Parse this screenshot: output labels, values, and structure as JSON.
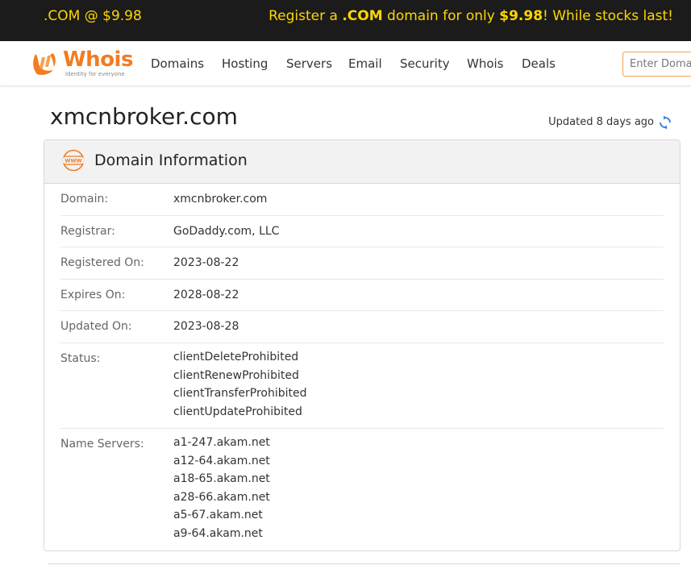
{
  "promo": {
    "left": ".COM @ $9.98",
    "right_prefix": "Register a ",
    "right_tld": ".COM",
    "right_mid": " domain for only ",
    "right_price": "$9.98",
    "right_suffix": "! While stocks last!"
  },
  "brand": {
    "name": "Whois",
    "tagline": "Identity for everyone",
    "accent": "#f47b20"
  },
  "nav": {
    "items": [
      "Domains",
      "Hosting",
      "Servers",
      "Email",
      "Security",
      "Whois",
      "Deals"
    ],
    "search_placeholder": "Enter Domain or IP"
  },
  "page": {
    "title": "xmcnbroker.com",
    "updated": "Updated 8 days ago"
  },
  "card": {
    "title": "Domain Information",
    "rows": [
      {
        "label": "Domain:",
        "values": [
          "xmcnbroker.com"
        ]
      },
      {
        "label": "Registrar:",
        "values": [
          "GoDaddy.com, LLC"
        ]
      },
      {
        "label": "Registered On:",
        "values": [
          "2023-08-22"
        ]
      },
      {
        "label": "Expires On:",
        "values": [
          "2028-08-22"
        ]
      },
      {
        "label": "Updated On:",
        "values": [
          "2023-08-28"
        ]
      },
      {
        "label": "Status:",
        "values": [
          "clientDeleteProhibited",
          "clientRenewProhibited",
          "clientTransferProhibited",
          "clientUpdateProhibited"
        ]
      },
      {
        "label": "Name Servers:",
        "values": [
          "a1-247.akam.net",
          "a12-64.akam.net",
          "a18-65.akam.net",
          "a28-66.akam.net",
          "a5-67.akam.net",
          "a9-64.akam.net"
        ]
      }
    ]
  },
  "icons": {
    "logo": "whois-logo-icon",
    "refresh": "refresh-icon",
    "www": "www-globe-icon"
  }
}
